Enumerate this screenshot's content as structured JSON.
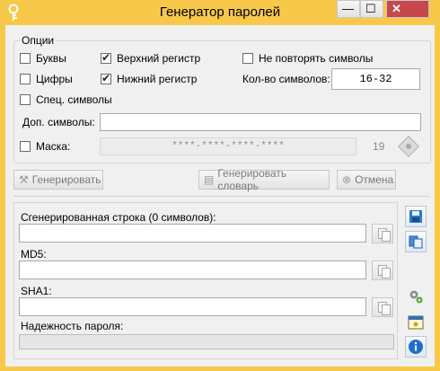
{
  "window": {
    "title": "Генератор паролей"
  },
  "titlebar": {
    "minimize_glyph": "—",
    "maximize_glyph": "☐",
    "close_glyph": "✕"
  },
  "options": {
    "legend": "Опции",
    "letters": {
      "label": "Буквы",
      "checked": false
    },
    "uppercase": {
      "label": "Верхний регистр",
      "checked": true
    },
    "no_repeat": {
      "label": "Не повторять символы",
      "checked": false
    },
    "digits": {
      "label": "Цифры",
      "checked": false
    },
    "lowercase": {
      "label": "Нижний регистр",
      "checked": true
    },
    "length_label": "Кол-во символов:",
    "length_value": "16-32",
    "special": {
      "label": "Спец. символы",
      "checked": false
    },
    "extra_label": "Доп. символы:",
    "extra_value": "",
    "mask": {
      "label": "Маска:",
      "checked": false,
      "value": "****-****-****-****",
      "count": "19"
    }
  },
  "actions": {
    "generate": "Генерировать",
    "generate_dict": "Генерировать словарь",
    "cancel": "Отмена"
  },
  "output": {
    "generated_label": "Сгенерированная строка (0 символов):",
    "generated_value": "",
    "md5_label": "MD5:",
    "md5_value": "",
    "sha1_label": "SHA1:",
    "sha1_value": "",
    "strength_label": "Надежность пароля:",
    "strength_fraction": 0
  },
  "icons": {
    "app": "key-icon",
    "generate": "wand-icon",
    "dict": "document-icon",
    "cancel": "cancel-icon",
    "mask_action": "diamond-icon",
    "copy": "copy-icon",
    "save": "save-icon",
    "paste": "paste-icon",
    "settings": "settings-icon",
    "calendar": "calendar-icon",
    "info": "info-icon"
  }
}
